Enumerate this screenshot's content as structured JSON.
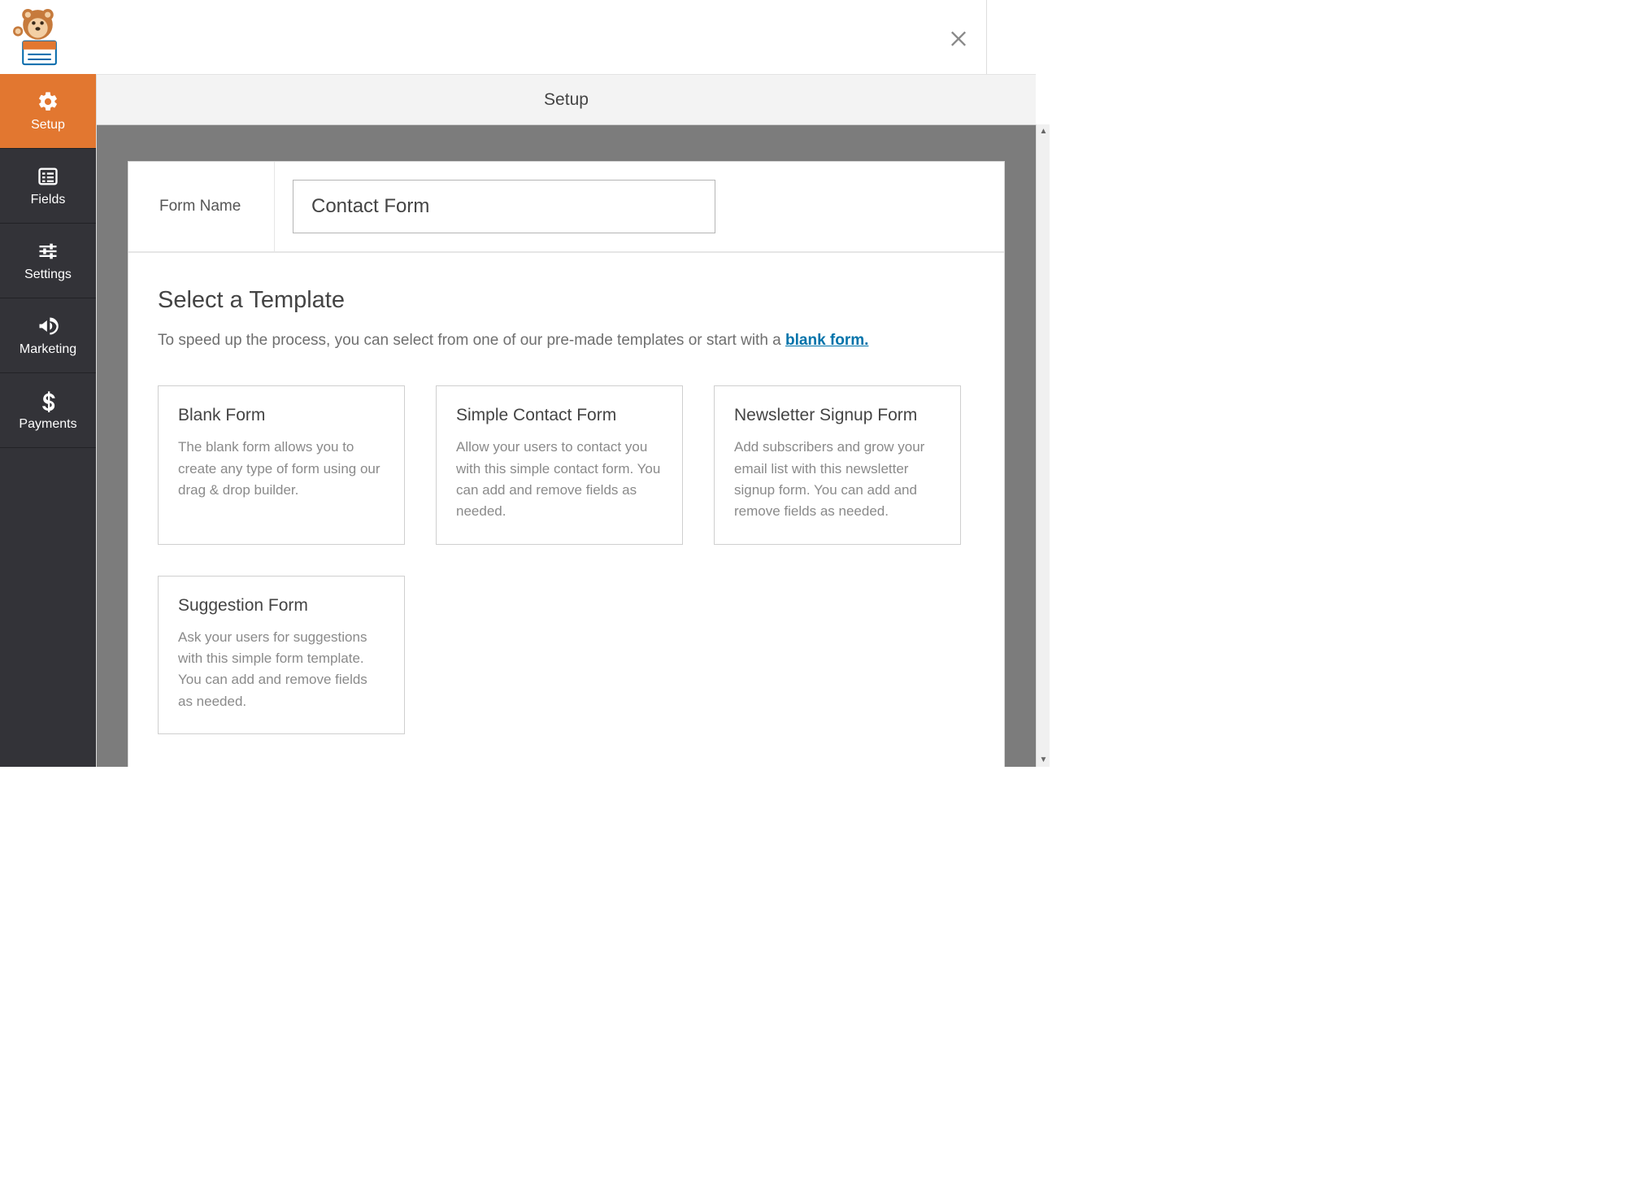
{
  "header": {
    "close_icon": "×"
  },
  "sidebar": {
    "items": [
      {
        "label": "Setup",
        "icon": "gear"
      },
      {
        "label": "Fields",
        "icon": "list"
      },
      {
        "label": "Settings",
        "icon": "sliders"
      },
      {
        "label": "Marketing",
        "icon": "bullhorn"
      },
      {
        "label": "Payments",
        "icon": "dollar"
      }
    ]
  },
  "page": {
    "title": "Setup",
    "form_name_label": "Form Name",
    "form_name_value": "Contact Form",
    "select_title": "Select a Template",
    "select_desc_prefix": "To speed up the process, you can select from one of our pre-made templates or start with a ",
    "select_desc_link": "blank form."
  },
  "templates": [
    {
      "title": "Blank Form",
      "desc": "The blank form allows you to create any type of form using our drag & drop builder."
    },
    {
      "title": "Simple Contact Form",
      "desc": "Allow your users to contact you with this simple contact form. You can add and remove fields as needed."
    },
    {
      "title": "Newsletter Signup Form",
      "desc": "Add subscribers and grow your email list with this newsletter signup form. You can add and remove fields as needed."
    },
    {
      "title": "Suggestion Form",
      "desc": "Ask your users for suggestions with this simple form template. You can add and remove fields as needed."
    }
  ]
}
